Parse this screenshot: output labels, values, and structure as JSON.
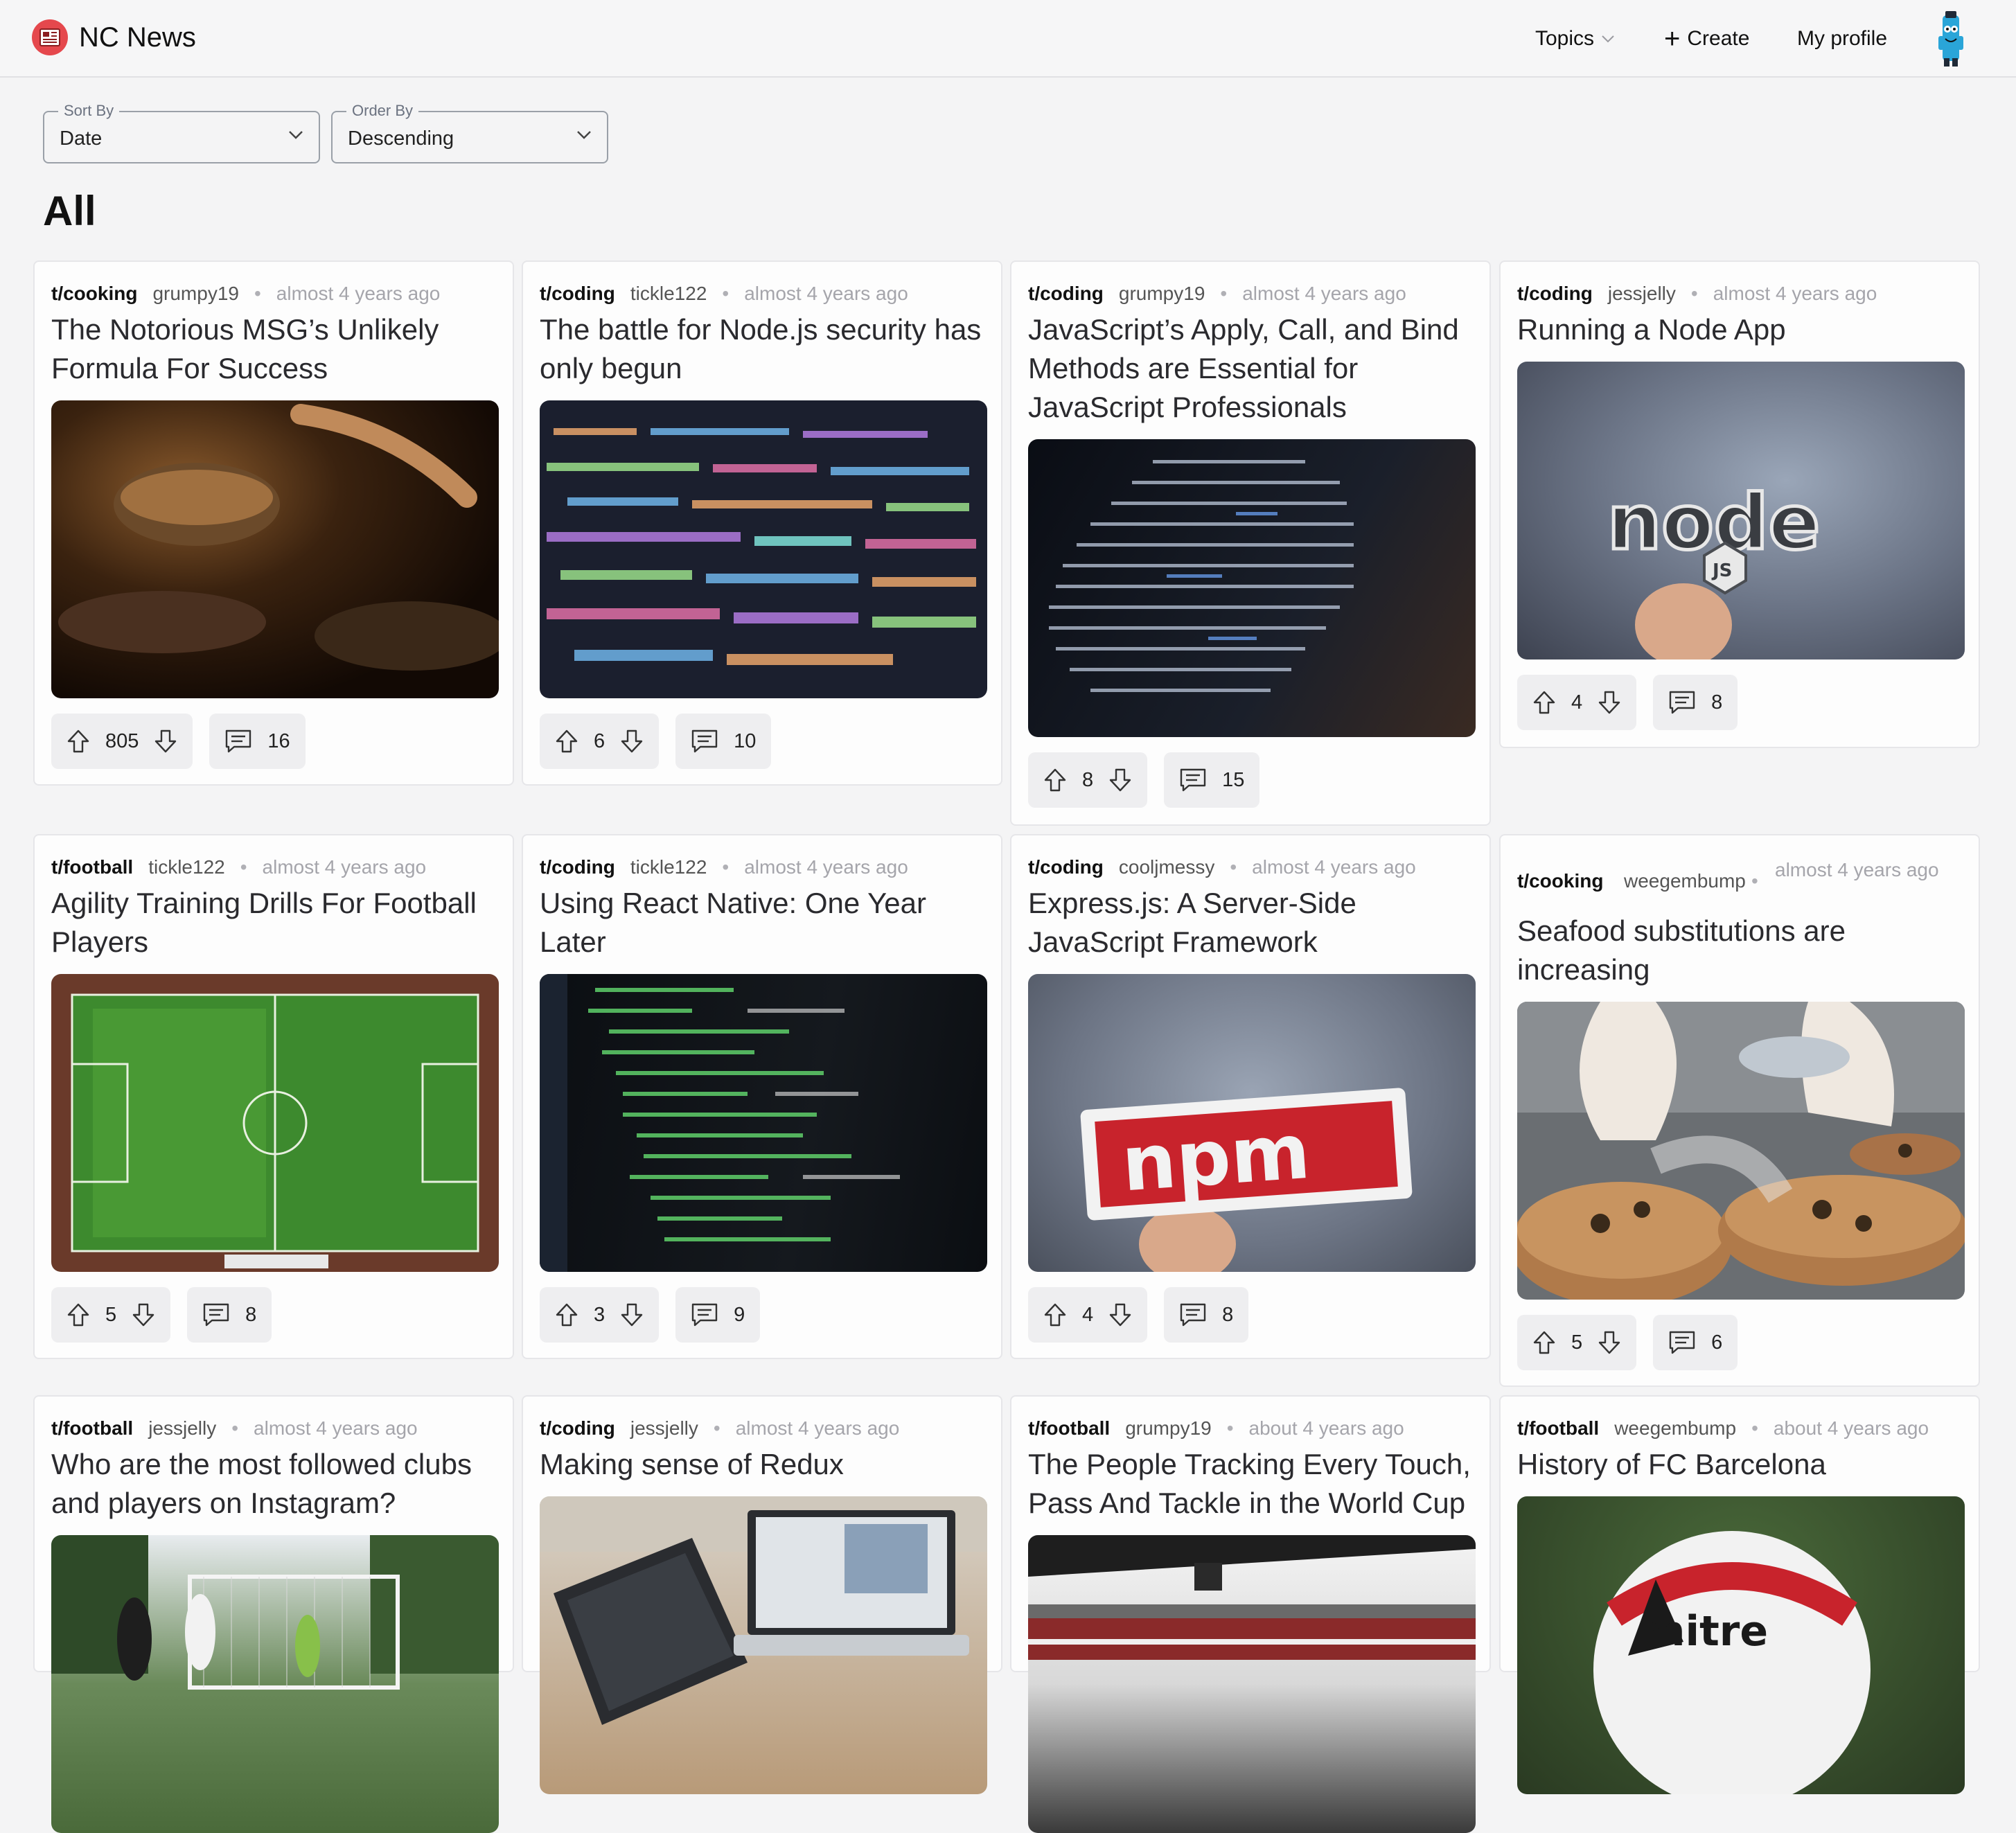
{
  "app": {
    "title": "NC News"
  },
  "nav": {
    "topics": "Topics",
    "create": "Create",
    "profile": "My profile"
  },
  "filters": {
    "sort": {
      "label": "Sort By",
      "value": "Date"
    },
    "order": {
      "label": "Order By",
      "value": "Descending"
    }
  },
  "page": {
    "title": "All"
  },
  "articles": [
    {
      "topic": "t/cooking",
      "author": "grumpy19",
      "time": "almost 4 years ago",
      "title": "The Notorious MSG’s Unlikely Formula For Success",
      "votes": "805",
      "comments": "16",
      "image": "cooking-pan-photo"
    },
    {
      "topic": "t/coding",
      "author": "tickle122",
      "time": "almost 4 years ago",
      "title": "The battle for Node.js security has only begun",
      "votes": "6",
      "comments": "10",
      "image": "code-screen-photo"
    },
    {
      "topic": "t/coding",
      "author": "grumpy19",
      "time": "almost 4 years ago",
      "title": "JavaScript’s Apply, Call, and Bind Methods are Essential for JavaScript Professionals",
      "votes": "8",
      "comments": "15",
      "image": "code-screen-dark-photo"
    },
    {
      "topic": "t/coding",
      "author": "jessjelly",
      "time": "almost 4 years ago",
      "title": "Running a Node App",
      "votes": "4",
      "comments": "8",
      "image": "node-sticker-photo"
    },
    {
      "topic": "t/football",
      "author": "tickle122",
      "time": "almost 4 years ago",
      "title": "Agility Training Drills For Football Players",
      "votes": "5",
      "comments": "8",
      "image": "football-pitch-photo"
    },
    {
      "topic": "t/coding",
      "author": "tickle122",
      "time": "almost 4 years ago",
      "title": "Using React Native: One Year Later",
      "votes": "3",
      "comments": "9",
      "image": "code-editor-photo"
    },
    {
      "topic": "t/coding",
      "author": "cooljmessy",
      "time": "almost 4 years ago",
      "title": "Express.js: A Server-Side JavaScript Framework",
      "votes": "4",
      "comments": "8",
      "image": "npm-sticker-photo"
    },
    {
      "topic": "t/cooking",
      "author": "weegembump",
      "time": "almost 4 years ago",
      "title": "Seafood substitutions are increasing",
      "votes": "5",
      "comments": "6",
      "image": "seafood-chef-photo"
    },
    {
      "topic": "t/football",
      "author": "jessjelly",
      "time": "almost 4 years ago",
      "title": "Who are the most followed clubs and players on Instagram?",
      "image": "football-goal-photo"
    },
    {
      "topic": "t/coding",
      "author": "jessjelly",
      "time": "almost 4 years ago",
      "title": "Making sense of Redux",
      "image": "laptops-photo"
    },
    {
      "topic": "t/football",
      "author": "grumpy19",
      "time": "about 4 years ago",
      "title": "The People Tracking Every Touch, Pass And Tackle in the World Cup",
      "image": "stadium-photo"
    },
    {
      "topic": "t/football",
      "author": "weegembump",
      "time": "about 4 years ago",
      "title": "History of FC Barcelona",
      "image": "mitre-ball-photo"
    }
  ]
}
